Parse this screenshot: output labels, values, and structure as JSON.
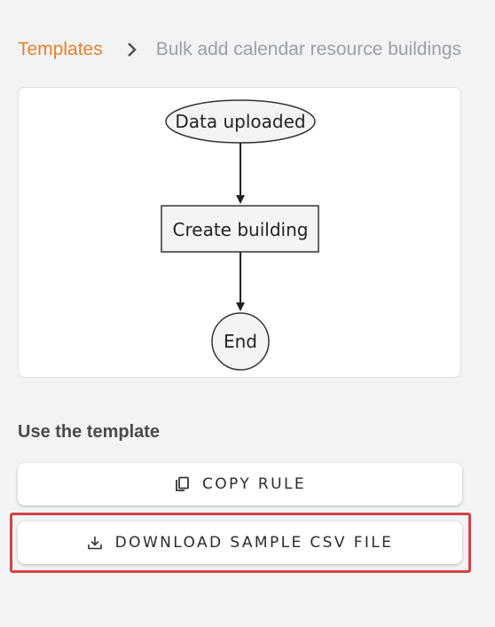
{
  "breadcrumb": {
    "link_label": "Templates",
    "current_label": "Bulk add calendar resource buildings"
  },
  "flow": {
    "nodes": {
      "start": "Data uploaded",
      "action": "Create building",
      "end": "End"
    }
  },
  "template_section": {
    "title": "Use the template",
    "copy_button_label": "COPY RULE",
    "download_button_label": "DOWNLOAD SAMPLE CSV FILE"
  },
  "colors": {
    "link": "#e8802e",
    "muted_text": "#9aa0a6",
    "highlight": "#d04545"
  },
  "icons": {
    "separator": "chevron-right-icon",
    "copy": "copy-icon",
    "download": "download-icon"
  }
}
